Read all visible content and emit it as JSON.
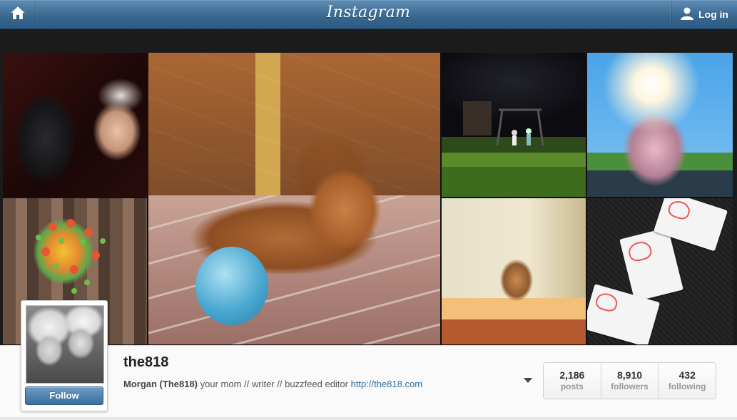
{
  "header": {
    "logo": "Instagram",
    "home_icon": "home-icon",
    "login_label": "Log in",
    "login_icon": "user-icon",
    "bar_color": "#3e6d96"
  },
  "photos": [
    {
      "name": "photo-darth-vader-selfie"
    },
    {
      "name": "photo-dog-with-blue-ball"
    },
    {
      "name": "photo-night-playground"
    },
    {
      "name": "photo-girl-sunlight"
    },
    {
      "name": "photo-vegetable-heart"
    },
    {
      "name": "photo-dog-window"
    },
    {
      "name": "photo-valentine-cards"
    }
  ],
  "profile": {
    "username": "the818",
    "full_name": "Morgan (The818)",
    "bio": " your mom // writer // buzzfeed editor ",
    "website": "http://the818.com",
    "follow_label": "Follow",
    "follow_color": "#3a6f9f",
    "stats": [
      {
        "value": "2,186",
        "label": "posts"
      },
      {
        "value": "8,910",
        "label": "followers"
      },
      {
        "value": "432",
        "label": "following"
      }
    ]
  }
}
